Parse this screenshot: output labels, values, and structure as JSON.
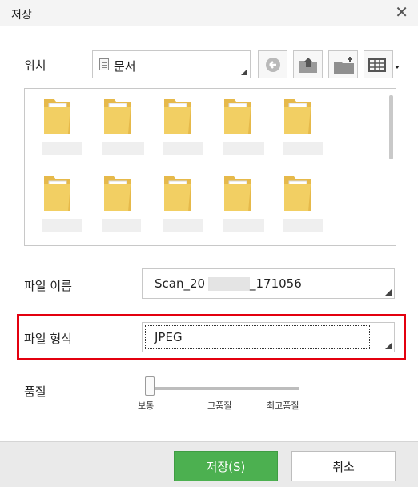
{
  "dialog": {
    "title": "저장",
    "close_icon": "close-icon"
  },
  "location": {
    "label": "위치",
    "value": "문서"
  },
  "toolbar": {
    "icons": [
      "back-icon",
      "up-folder-icon",
      "new-folder-icon",
      "view-menu-icon"
    ]
  },
  "file_list": {
    "items": [
      {
        "type": "folder"
      },
      {
        "type": "folder"
      },
      {
        "type": "folder"
      },
      {
        "type": "folder"
      },
      {
        "type": "folder"
      },
      {
        "type": "folder"
      },
      {
        "type": "folder"
      },
      {
        "type": "folder"
      },
      {
        "type": "folder"
      },
      {
        "type": "folder"
      }
    ]
  },
  "filename": {
    "label": "파일 이름",
    "value_prefix": "Scan_20",
    "value_suffix": "_171056"
  },
  "format": {
    "label": "파일 형식",
    "value": "JPEG"
  },
  "quality": {
    "label": "품질",
    "ticks": [
      "보통",
      "고품질",
      "최고품질"
    ],
    "selected_index": 0
  },
  "buttons": {
    "save": "저장(S)",
    "cancel": "취소"
  },
  "colors": {
    "save_button": "#4cb050",
    "highlight": "#e3000f",
    "folder": "#f2cf63"
  }
}
